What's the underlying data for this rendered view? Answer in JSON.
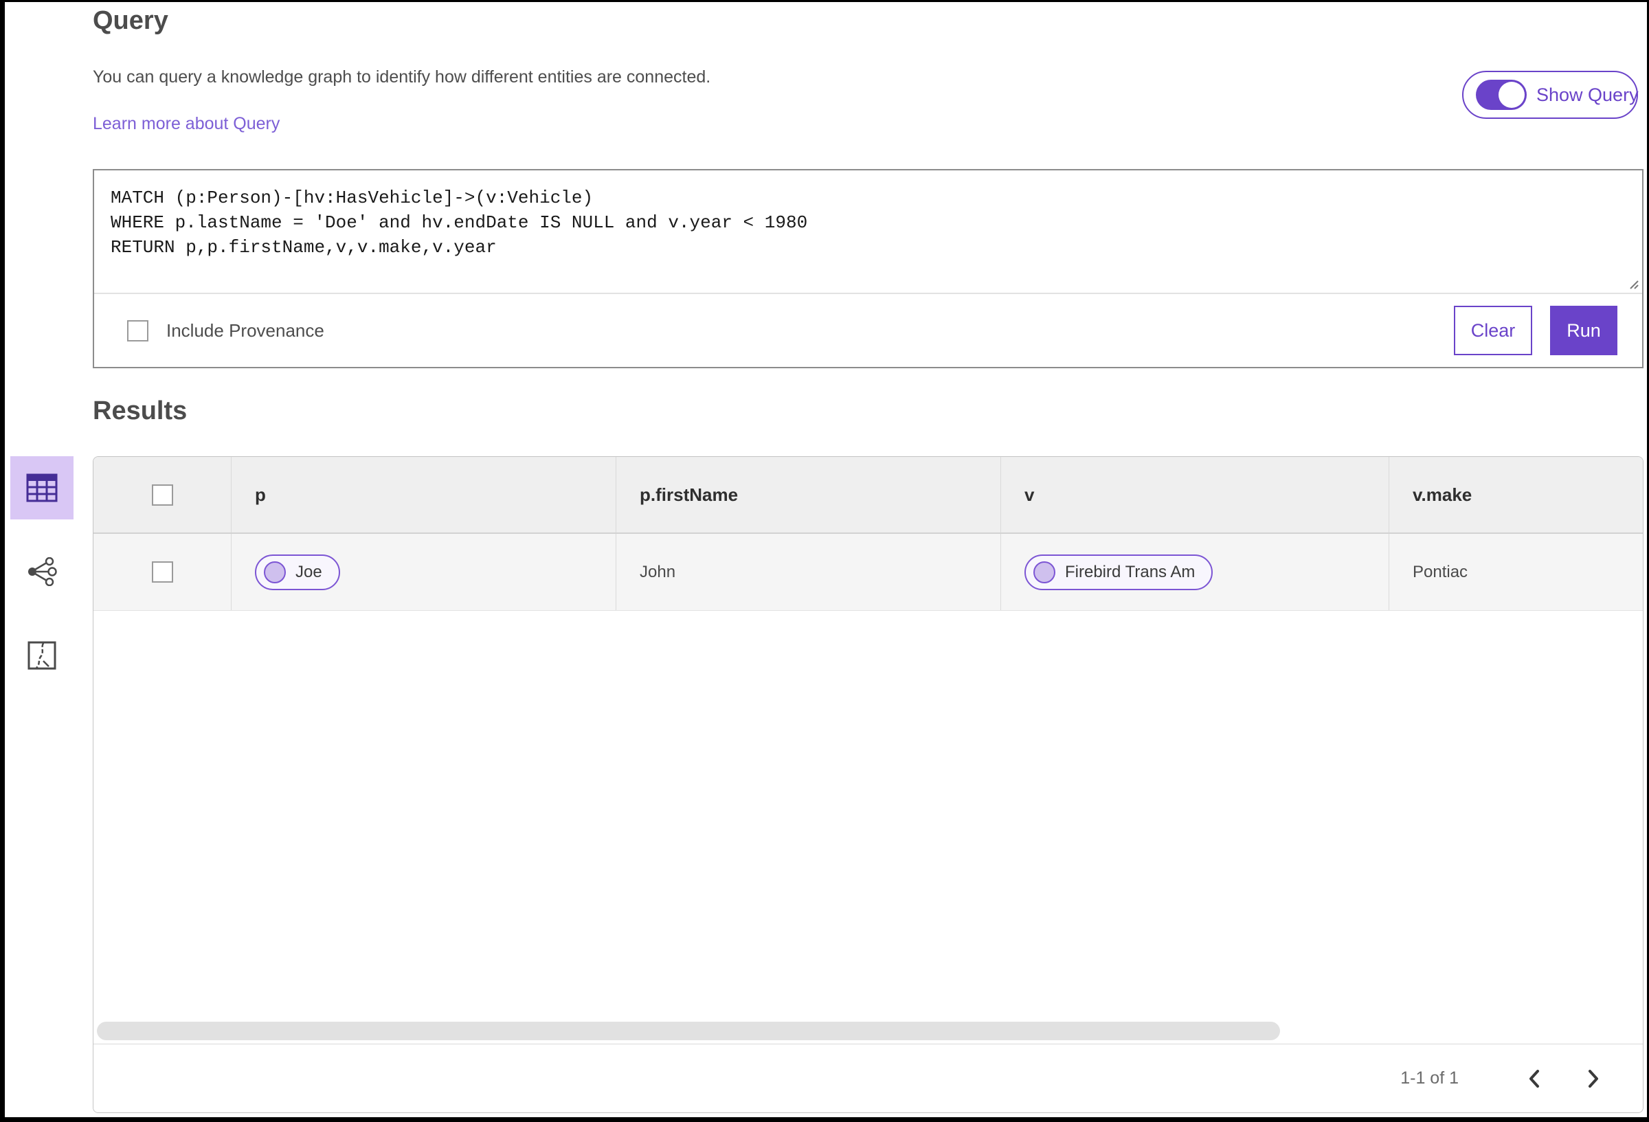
{
  "page": {
    "title": "Query",
    "description": "You can query a knowledge graph to identify how different entities are connected.",
    "learn_more_link": "Learn more about Query",
    "show_query_toggle": {
      "label": "Show Query",
      "state": "on"
    }
  },
  "query_editor": {
    "code": "MATCH (p:Person)-[hv:HasVehicle]->(v:Vehicle)\nWHERE p.lastName = 'Doe' and hv.endDate IS NULL and v.year < 1980\nRETURN p,p.firstName,v,v.make,v.year",
    "include_provenance": {
      "label": "Include Provenance",
      "checked": false
    },
    "clear_button": "Clear",
    "run_button": "Run"
  },
  "results": {
    "title": "Results",
    "view_tabs": [
      {
        "name": "table-view",
        "icon": "table-icon",
        "active": true
      },
      {
        "name": "link-chart-view",
        "icon": "link-chart-icon",
        "active": false
      },
      {
        "name": "map-view",
        "icon": "map-icon",
        "active": false
      }
    ],
    "table": {
      "columns": [
        "p",
        "p.firstName",
        "v",
        "v.make"
      ],
      "rows": [
        {
          "selected": false,
          "cells": [
            {
              "kind": "entity-pill",
              "label": "Joe"
            },
            {
              "kind": "text",
              "value": "John"
            },
            {
              "kind": "entity-pill",
              "label": "Firebird Trans Am"
            },
            {
              "kind": "text",
              "value": "Pontiac"
            }
          ]
        }
      ]
    },
    "pagination": {
      "range_label": "1-1 of 1",
      "prev_icon": "chevron-left-icon",
      "next_icon": "chevron-right-icon"
    }
  },
  "colors": {
    "accent_purple": "#6a43c9",
    "link_purple": "#7d5fd6",
    "active_tab_bg": "#d9c7f5",
    "pill_border": "#7c55d4",
    "pill_bg": "#f8f6fd",
    "pill_dot": "#cfc0ee",
    "table_header_bg": "#efefef",
    "table_row_bg": "#f5f5f5",
    "panel_border": "#c4c4c4",
    "query_box_border": "#8c8c8c"
  }
}
